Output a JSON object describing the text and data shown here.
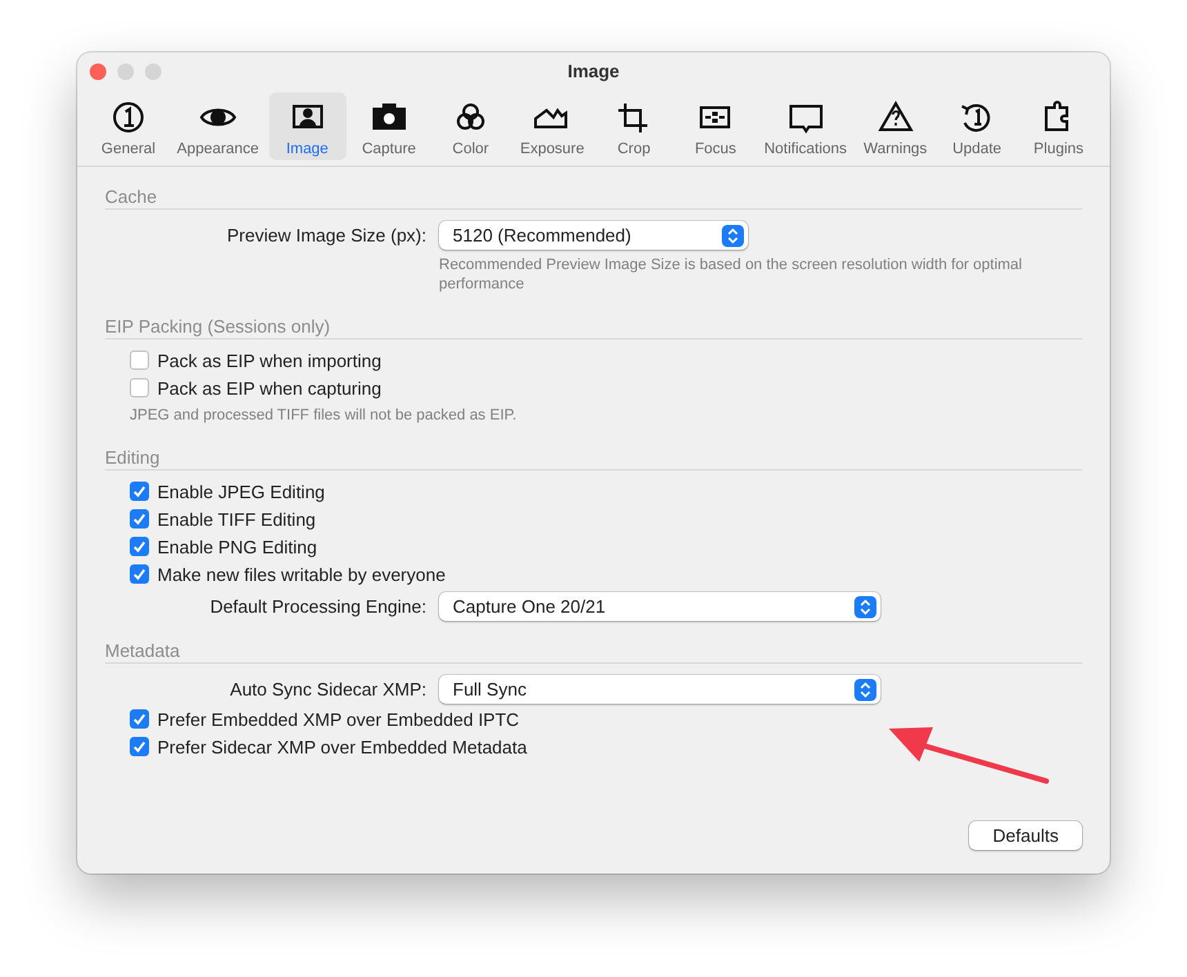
{
  "window": {
    "title": "Image"
  },
  "tabs": [
    {
      "label": "General",
      "selected": false
    },
    {
      "label": "Appearance",
      "selected": false
    },
    {
      "label": "Image",
      "selected": true
    },
    {
      "label": "Capture",
      "selected": false
    },
    {
      "label": "Color",
      "selected": false
    },
    {
      "label": "Exposure",
      "selected": false
    },
    {
      "label": "Crop",
      "selected": false
    },
    {
      "label": "Focus",
      "selected": false
    },
    {
      "label": "Notifications",
      "selected": false
    },
    {
      "label": "Warnings",
      "selected": false
    },
    {
      "label": "Update",
      "selected": false
    },
    {
      "label": "Plugins",
      "selected": false
    }
  ],
  "sections": [
    {
      "title": "Cache",
      "items": [
        {
          "kind": "select",
          "label": "Preview Image Size (px):",
          "value": "5120 (Recommended)",
          "wide": false,
          "note": "Recommended Preview Image Size is based on the screen resolution width for optimal performance"
        }
      ]
    },
    {
      "title": "EIP Packing (Sessions only)",
      "items": [
        {
          "kind": "checkbox",
          "label": "Pack as EIP when importing",
          "checked": false
        },
        {
          "kind": "checkbox",
          "label": "Pack as EIP when capturing",
          "checked": false
        },
        {
          "kind": "note",
          "label": "JPEG and processed TIFF files will not be packed as EIP."
        }
      ]
    },
    {
      "title": "Editing",
      "items": [
        {
          "kind": "checkbox",
          "label": "Enable JPEG Editing",
          "checked": true
        },
        {
          "kind": "checkbox",
          "label": "Enable TIFF Editing",
          "checked": true
        },
        {
          "kind": "checkbox",
          "label": "Enable PNG Editing",
          "checked": true
        },
        {
          "kind": "checkbox",
          "label": "Make new files writable by everyone",
          "checked": true
        },
        {
          "kind": "select",
          "label": "Default Processing Engine:",
          "value": "Capture One 20/21",
          "wide": true
        }
      ]
    },
    {
      "title": "Metadata",
      "items": [
        {
          "kind": "select",
          "label": "Auto Sync Sidecar XMP:",
          "value": "Full Sync",
          "wide": true
        },
        {
          "kind": "checkbox",
          "label": "Prefer Embedded XMP over Embedded IPTC",
          "checked": true
        },
        {
          "kind": "checkbox",
          "label": "Prefer Sidecar XMP over Embedded Metadata",
          "checked": true
        }
      ]
    }
  ],
  "buttons": [
    "Defaults"
  ]
}
